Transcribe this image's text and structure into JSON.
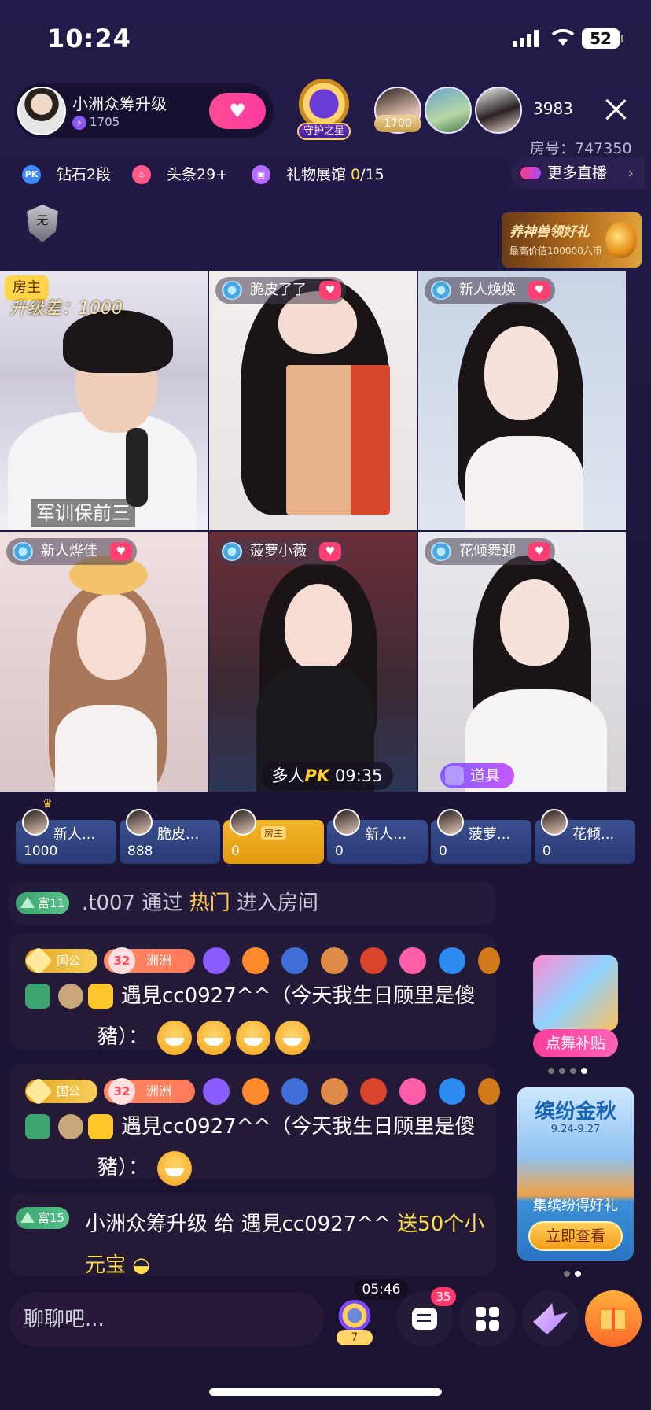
{
  "status_bar": {
    "time": "10:24",
    "battery": "52"
  },
  "host": {
    "name": "小洲众筹升级",
    "heat": "1705"
  },
  "guard_badge": "守护之星",
  "top_viewers": [
    {
      "tag": "1700"
    }
  ],
  "viewer_count": "3983",
  "room_number": "房号：747350",
  "pills": {
    "pk": "PK",
    "rank": "钻石2段",
    "headline": "头条29+",
    "gallery_label": "礼物展馆 ",
    "gallery_have": "0",
    "gallery_total": "/15"
  },
  "more_live": "更多直播",
  "rank_badge_letter": "无",
  "promo_banner": {
    "title": "养神兽领好礼",
    "subtitle": "最高价值100000六币"
  },
  "grid": {
    "host_tag": "房主",
    "upgrade_gap": "升级差：1000",
    "host_caption": "军训保前三",
    "tiles": [
      {
        "name": "脆皮了了"
      },
      {
        "name": "新人焕焕"
      },
      {
        "name": "新人烨佳"
      },
      {
        "name": "菠萝小薇"
      },
      {
        "name": "花倾舞迎"
      }
    ],
    "pk_prefix": "多人",
    "pk_label": "PK",
    "pk_time": "09:35",
    "props_label": "道具"
  },
  "scoreboard": [
    {
      "name": "新人...",
      "value": "1000"
    },
    {
      "name": "脆皮...",
      "value": "888"
    },
    {
      "name": "房主",
      "value": "0"
    },
    {
      "name": "新人...",
      "value": "0"
    },
    {
      "name": "菠萝...",
      "value": "0"
    },
    {
      "name": "花倾...",
      "value": "0"
    }
  ],
  "chat": {
    "enter": {
      "level": "富11",
      "user": ".t007",
      "via": "通过",
      "source": "热门",
      "action": "进入房间"
    },
    "messages": [
      {
        "title": "国公",
        "heart_level": "32",
        "club": "洲洲",
        "user": "遇見cc0927^^",
        "text": "（今天我生日顾里是傻豬）："
      },
      {
        "title": "国公",
        "heart_level": "32",
        "club": "洲洲",
        "user": "遇見cc0927^^",
        "text": "（今天我生日顾里是傻豬）："
      }
    ],
    "gift": {
      "level": "富15",
      "from": "小洲众筹升级",
      "verb": "给",
      "to": "遇見cc0927^^",
      "gift": "送50个小元宝"
    }
  },
  "side_promos": {
    "dance": "点舞补贴",
    "autumn_title": "缤纷金秋",
    "autumn_dates": "9.24-9.27",
    "autumn_sub": "集缤纷得好礼",
    "autumn_btn": "立即查看"
  },
  "bottom_bar": {
    "placeholder": "聊聊吧...",
    "timer": "05:46",
    "crown_count": "7",
    "chat_count": "35"
  }
}
